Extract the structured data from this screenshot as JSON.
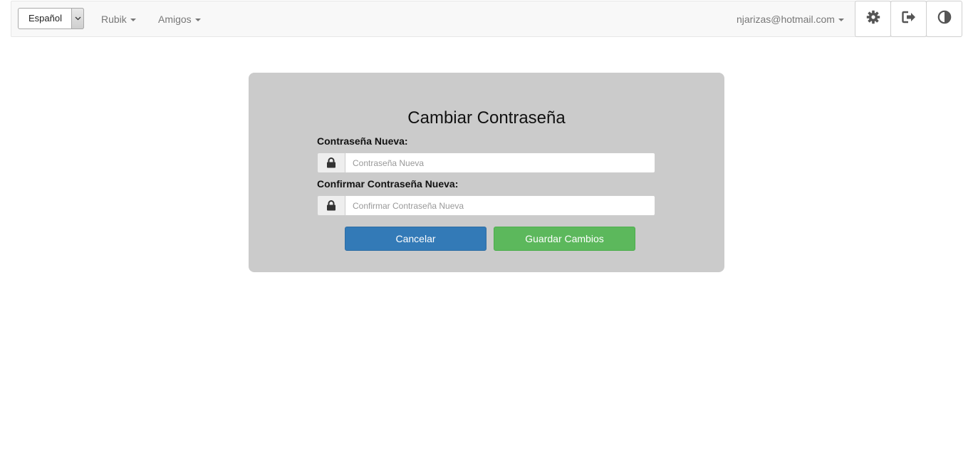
{
  "navbar": {
    "language": {
      "selected": "Español"
    },
    "menus": [
      {
        "label": "Rubik"
      },
      {
        "label": "Amigos"
      }
    ],
    "user": {
      "email": "njarizas@hotmail.com"
    },
    "icons": [
      "settings-gear-icon",
      "logout-icon",
      "contrast-icon"
    ]
  },
  "form": {
    "title": "Cambiar Contraseña",
    "new_password": {
      "label": "Contraseña Nueva:",
      "placeholder": "Contraseña Nueva",
      "value": "",
      "icon": "lock-icon"
    },
    "confirm_password": {
      "label": "Confirmar Contraseña Nueva:",
      "placeholder": "Confirmar Contraseña Nueva",
      "value": "",
      "icon": "lock-icon"
    },
    "cancel_label": "Cancelar",
    "save_label": "Guardar Cambios"
  },
  "colors": {
    "navbar_bg": "#f8f8f8",
    "panel_bg": "#cbcbcb",
    "cancel_button": "#337ab7",
    "save_button": "#5cb85c"
  }
}
